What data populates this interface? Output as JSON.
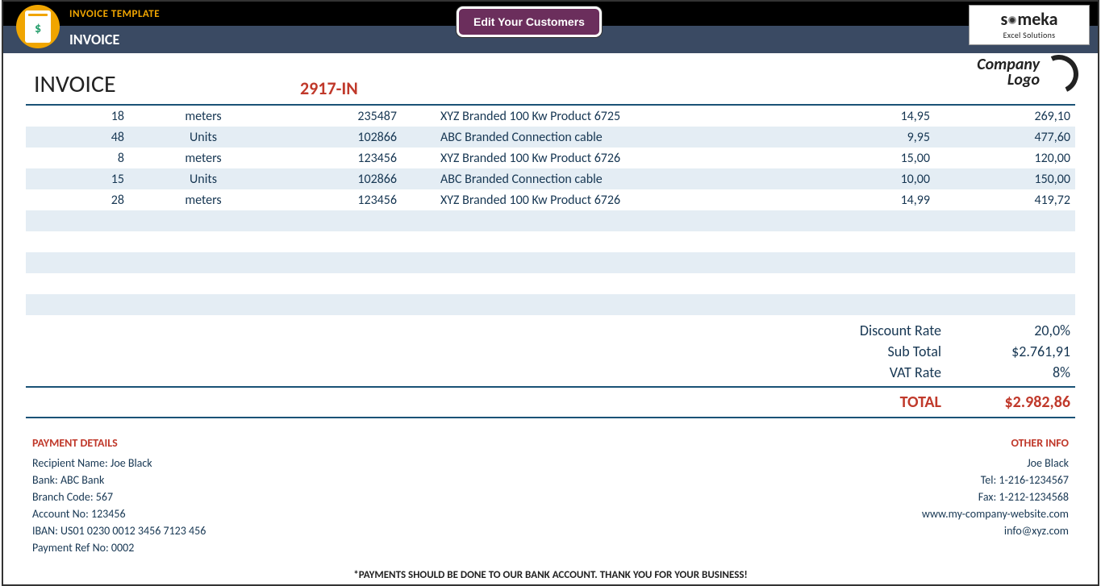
{
  "header": {
    "template_title": "INVOICE TEMPLATE",
    "page_title": "INVOICE",
    "edit_button": "Edit Your Customers",
    "someka_brand": "someka",
    "someka_tag": "Excel Solutions"
  },
  "invoice": {
    "label": "INVOICE",
    "number": "2917-IN",
    "company_logo_line1": "Company",
    "company_logo_line2": "Logo"
  },
  "items": [
    {
      "qty": "18",
      "unit": "meters",
      "code": "235487",
      "desc": "XYZ Branded 100 Kw Product 6725",
      "price": "14,95",
      "total": "269,10"
    },
    {
      "qty": "48",
      "unit": "Units",
      "code": "102866",
      "desc": "ABC Branded Connection cable",
      "price": "9,95",
      "total": "477,60"
    },
    {
      "qty": "8",
      "unit": "meters",
      "code": "123456",
      "desc": "XYZ Branded 100 Kw Product 6726",
      "price": "15,00",
      "total": "120,00"
    },
    {
      "qty": "15",
      "unit": "Units",
      "code": "102866",
      "desc": "ABC Branded Connection cable",
      "price": "10,00",
      "total": "150,00"
    },
    {
      "qty": "28",
      "unit": "meters",
      "code": "123456",
      "desc": "XYZ Branded 100 Kw Product 6726",
      "price": "14,99",
      "total": "419,72"
    }
  ],
  "summary": {
    "discount_label": "Discount Rate",
    "discount_value": "20,0%",
    "subtotal_label": "Sub Total",
    "subtotal_value": "$2.761,91",
    "vat_label": "VAT Rate",
    "vat_value": "8%",
    "total_label": "TOTAL",
    "total_value": "$2.982,86"
  },
  "payment": {
    "header": "PAYMENT DETAILS",
    "recipient": "Recipient Name: Joe Black",
    "bank": "Bank: ABC Bank",
    "branch": "Branch Code: 567",
    "account": "Account No: 123456",
    "iban": "IBAN: US01 0230 0012 3456 7123 456",
    "ref": "Payment Ref No: 0002"
  },
  "other": {
    "header": "OTHER INFO",
    "name": "Joe Black",
    "tel": "Tel: 1-216-1234567",
    "fax": "Fax: 1-212-1234568",
    "web": "www.my-company-website.com",
    "email": "info@xyz.com"
  },
  "footnote": "*PAYMENTS SHOULD BE DONE TO OUR BANK ACCOUNT. THANK YOU FOR YOUR BUSINESS!"
}
